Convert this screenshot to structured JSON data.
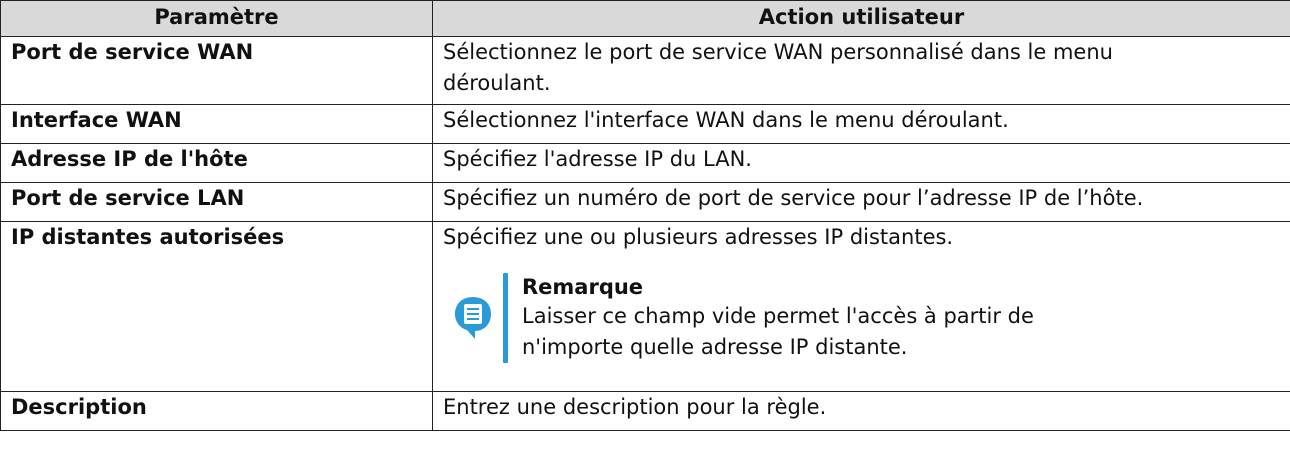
{
  "table": {
    "headers": {
      "parameter": "Paramètre",
      "action": "Action utilisateur"
    },
    "rows": [
      {
        "parameter": "Port de service WAN",
        "action_line1": "Sélectionnez le port de service WAN personnalisé dans le menu",
        "action_line2": "déroulant."
      },
      {
        "parameter": "Interface WAN",
        "action": "Sélectionnez l'interface WAN dans le menu déroulant."
      },
      {
        "parameter": "Adresse IP de l'hôte",
        "action": "Spécifiez l'adresse IP du LAN."
      },
      {
        "parameter": "Port de service LAN",
        "action": "Spécifiez un numéro de port de service pour l’adresse IP de l’hôte."
      },
      {
        "parameter": "IP distantes autorisées",
        "action": "Spécifiez une ou plusieurs adresses IP distantes.",
        "note": {
          "title": "Remarque",
          "line1": "Laisser ce champ vide permet l'accès à partir de",
          "line2": "n'importe quelle adresse IP distante.",
          "icon": "note-icon",
          "accent_color": "#2a9bd6"
        }
      },
      {
        "parameter": "Description",
        "action": "Entrez une description pour la règle."
      }
    ]
  }
}
